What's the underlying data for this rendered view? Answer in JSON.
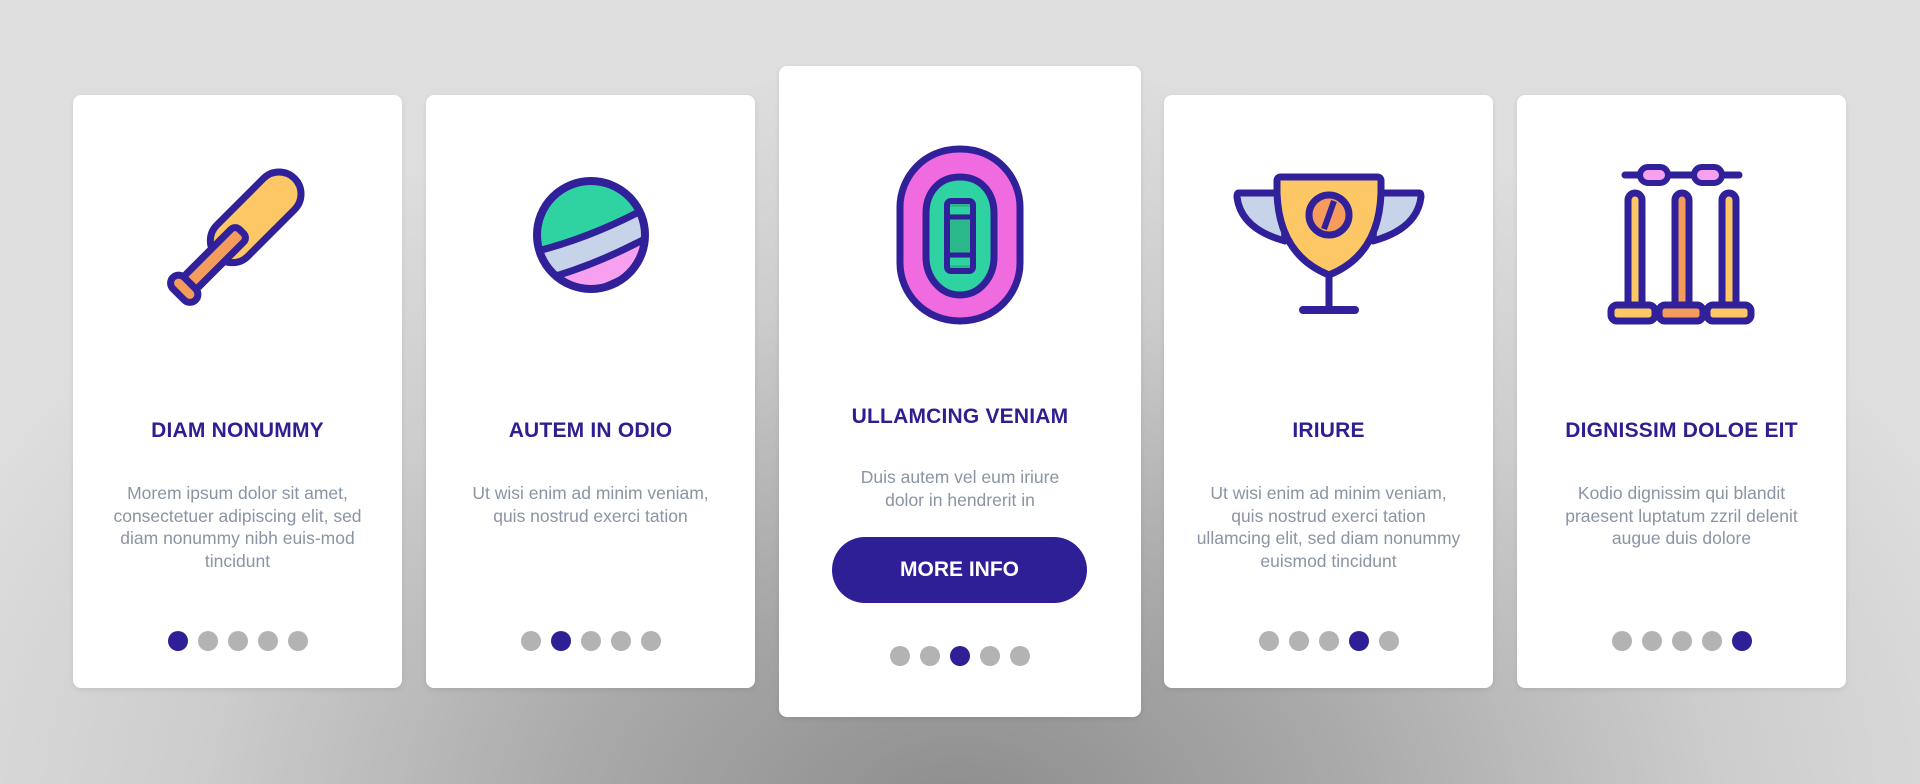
{
  "colors": {
    "accent": "#2e1f96",
    "title": "#2e1f8f",
    "body_text": "#8a94a3",
    "dot_inactive": "#b3b3b3",
    "icon_outline": "#30209a",
    "yellow": "#fdc765",
    "orange": "#f59b5c",
    "green": "#2fd3a2",
    "pink": "#f06ae0",
    "light_pink": "#f7a0ef",
    "light_blue": "#c6d3e8"
  },
  "cards": [
    {
      "icon": "cricket-bat-icon",
      "title": "DIAM NONUMMY",
      "body": "Morem ipsum dolor sit amet, consectetuer adipiscing elit, sed diam nonummy nibh euis-mod tincidunt",
      "active_page": 1,
      "total_pages": 5
    },
    {
      "icon": "cricket-ball-icon",
      "title": "AUTEM IN ODIO",
      "body": "Ut wisi enim ad minim veniam, quis nostrud exerci tation",
      "active_page": 2,
      "total_pages": 5
    },
    {
      "icon": "cricket-stadium-icon",
      "title": "ULLAMCING VENIAM",
      "body": "Duis autem vel eum iriure dolor in hendrerit in",
      "button_label": "MORE INFO",
      "active_page": 3,
      "total_pages": 5
    },
    {
      "icon": "trophy-icon",
      "title": "IRIURE",
      "body": "Ut wisi enim ad minim veniam, quis nostrud exerci tation ullamcing elit, sed diam nonummy euismod tincidunt",
      "active_page": 4,
      "total_pages": 5
    },
    {
      "icon": "cricket-wicket-icon",
      "title": "DIGNISSIM DOLOE EIT",
      "body": "Kodio dignissim qui blandit praesent luptatum zzril delenit augue duis dolore",
      "active_page": 5,
      "total_pages": 5
    }
  ]
}
